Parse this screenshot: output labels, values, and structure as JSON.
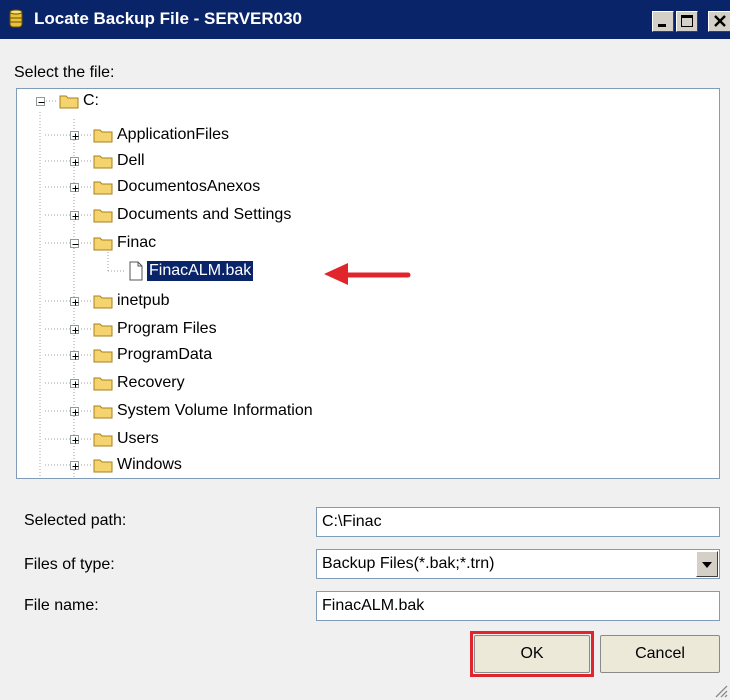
{
  "window": {
    "title": "Locate Backup File - SERVER030",
    "controls": [
      "minimize-icon",
      "maximize-icon",
      "close-icon"
    ]
  },
  "select_label": "Select the file:",
  "tree": {
    "root": "C:",
    "folders": [
      "ApplicationFiles",
      "Dell",
      "DocumentosAnexos",
      "Documents and Settings",
      "Finac",
      "FinacALM.bak",
      "inetpub",
      "Program Files",
      "ProgramData",
      "Recovery",
      "System Volume Information",
      "Users",
      "Windows"
    ],
    "selected": "FinacALM.bak",
    "expanded": [
      "C:",
      "Finac"
    ]
  },
  "form": {
    "selected_path_label": "Selected path:",
    "selected_path_value": "C:\\Finac",
    "files_of_type_label": "Files of type:",
    "files_of_type_value": "Backup Files(*.bak;*.trn)",
    "file_name_label": "File name:",
    "file_name_value": "FinacALM.bak"
  },
  "buttons": {
    "ok": "OK",
    "cancel": "Cancel"
  },
  "colors": {
    "titlebar": "#0a246a",
    "selection": "#0a246a",
    "annotation_red": "#e0252c",
    "folder_yellow": "#f5d470"
  }
}
